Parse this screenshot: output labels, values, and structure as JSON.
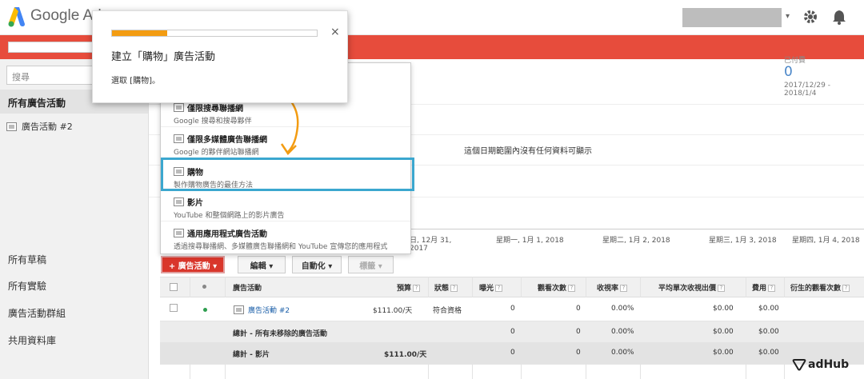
{
  "header": {
    "logo_text": "Google Ad",
    "account_caret": "▾"
  },
  "sidebar": {
    "search_placeholder": "搜尋",
    "all_campaigns": "所有廣告活動",
    "campaign_item": "廣告活動 #2",
    "links": [
      "所有草稿",
      "所有實驗",
      "廣告活動群組",
      "共用資料庫"
    ]
  },
  "stats": {
    "label": "已付費",
    "value": "0",
    "range": "2017/12/29 - 2018/1/4"
  },
  "chart": {
    "empty_message": "這個日期範圍內沒有任何資料可顯示",
    "axis_labels": [
      "日, 12月 31, 2017",
      "星期一, 1月 1, 2018",
      "星期二, 1月 2, 2018",
      "星期三, 1月 3, 2018",
      "星期四, 1月 4, 2018"
    ]
  },
  "toolbar": {
    "campaign_btn": "+ 廣告活動 ▾",
    "edit_btn": "編輯 ▾",
    "auto_btn": "自動化 ▾",
    "label_btn": "標籤 ▾"
  },
  "table": {
    "headers": {
      "campaign": "廣告活動",
      "budget": "預算",
      "status": "狀態",
      "impressions": "曝光",
      "views": "觀看次數",
      "view_rate": "收視率",
      "avg_cpv": "平均單次收視出價",
      "cost": "費用",
      "earned_views": "衍生的觀看次數"
    },
    "rows": [
      {
        "name": "廣告活動 #2",
        "budget": "$111.00/天",
        "status": "符合資格",
        "impressions": "0",
        "views": "0",
        "view_rate": "0.00%",
        "avg_cpv": "$0.00",
        "cost": "$0.00"
      },
      {
        "name": "總計 - 所有未移除的廣告活動",
        "impressions": "0",
        "views": "0",
        "view_rate": "0.00%",
        "avg_cpv": "$0.00",
        "cost": "$0.00"
      },
      {
        "name": "總計 - 影片",
        "budget": "$111.00/天",
        "impressions": "0",
        "views": "0",
        "view_rate": "0.00%",
        "avg_cpv": "$0.00",
        "cost": "$0.00"
      }
    ]
  },
  "menu": {
    "items": [
      {
        "title": "僅限搜尋聯播網",
        "desc": "Google 搜尋和搜尋夥伴"
      },
      {
        "title": "僅限多媒體廣告聯播網",
        "desc": "Google 的夥伴網站聯播網"
      },
      {
        "title": "購物",
        "desc": "製作購物廣告的最佳方法"
      },
      {
        "title": "影片",
        "desc": "YouTube 和整個網路上的影片廣告"
      },
      {
        "title": "通用應用程式廣告活動",
        "desc": "透過搜尋聯播網、多媒體廣告聯播網和 YouTube 宣傳您的應用程式"
      }
    ]
  },
  "popup": {
    "title": "建立「購物」廣告活動",
    "subtitle": "選取 [購物]。",
    "close": "×",
    "progress": 0.27
  },
  "watermark": "adHub",
  "colors": {
    "red_banner": "#e74c3c",
    "accent_blue": "#4a86c8",
    "highlight": "#3ba7cf",
    "progress": "#f39c12",
    "status_green": "#2e9e4f"
  }
}
